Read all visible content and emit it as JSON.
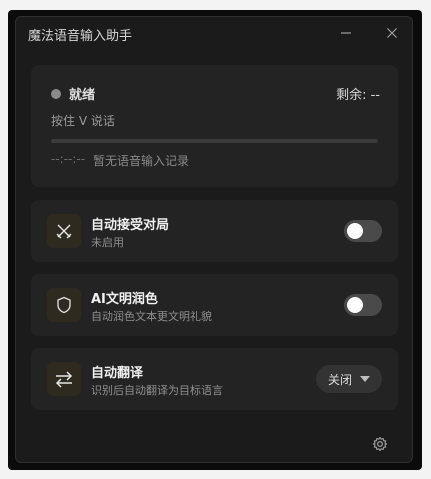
{
  "window": {
    "title": "魔法语音输入助手",
    "minimize_icon": "minimize-icon",
    "close_icon": "close-icon"
  },
  "status": {
    "state_label": "就绪",
    "state_color": "#8c8c8c",
    "remaining": "剩余: --",
    "hint": "按住 V 说话",
    "progress": 0,
    "last_time": "--:--:--",
    "no_record": "暂无语音输入记录"
  },
  "features": [
    {
      "icon": "crossed-swords-icon",
      "name": "自动接受对局",
      "desc": "未启用",
      "enabled": false
    },
    {
      "icon": "shield-icon",
      "name": "AI文明润色",
      "desc": "自动润色文本更文明礼貌",
      "enabled": false
    },
    {
      "icon": "swap-arrows-icon",
      "name": "自动翻译",
      "desc": "识别后自动翻译为目标语言",
      "select_value": "关闭"
    }
  ],
  "footer": {
    "settings_icon": "gear-icon"
  },
  "colors": {
    "accent_icon_bg": "#2e2a20",
    "card_bg": "#232323",
    "window_bg": "#1b1b1b"
  }
}
